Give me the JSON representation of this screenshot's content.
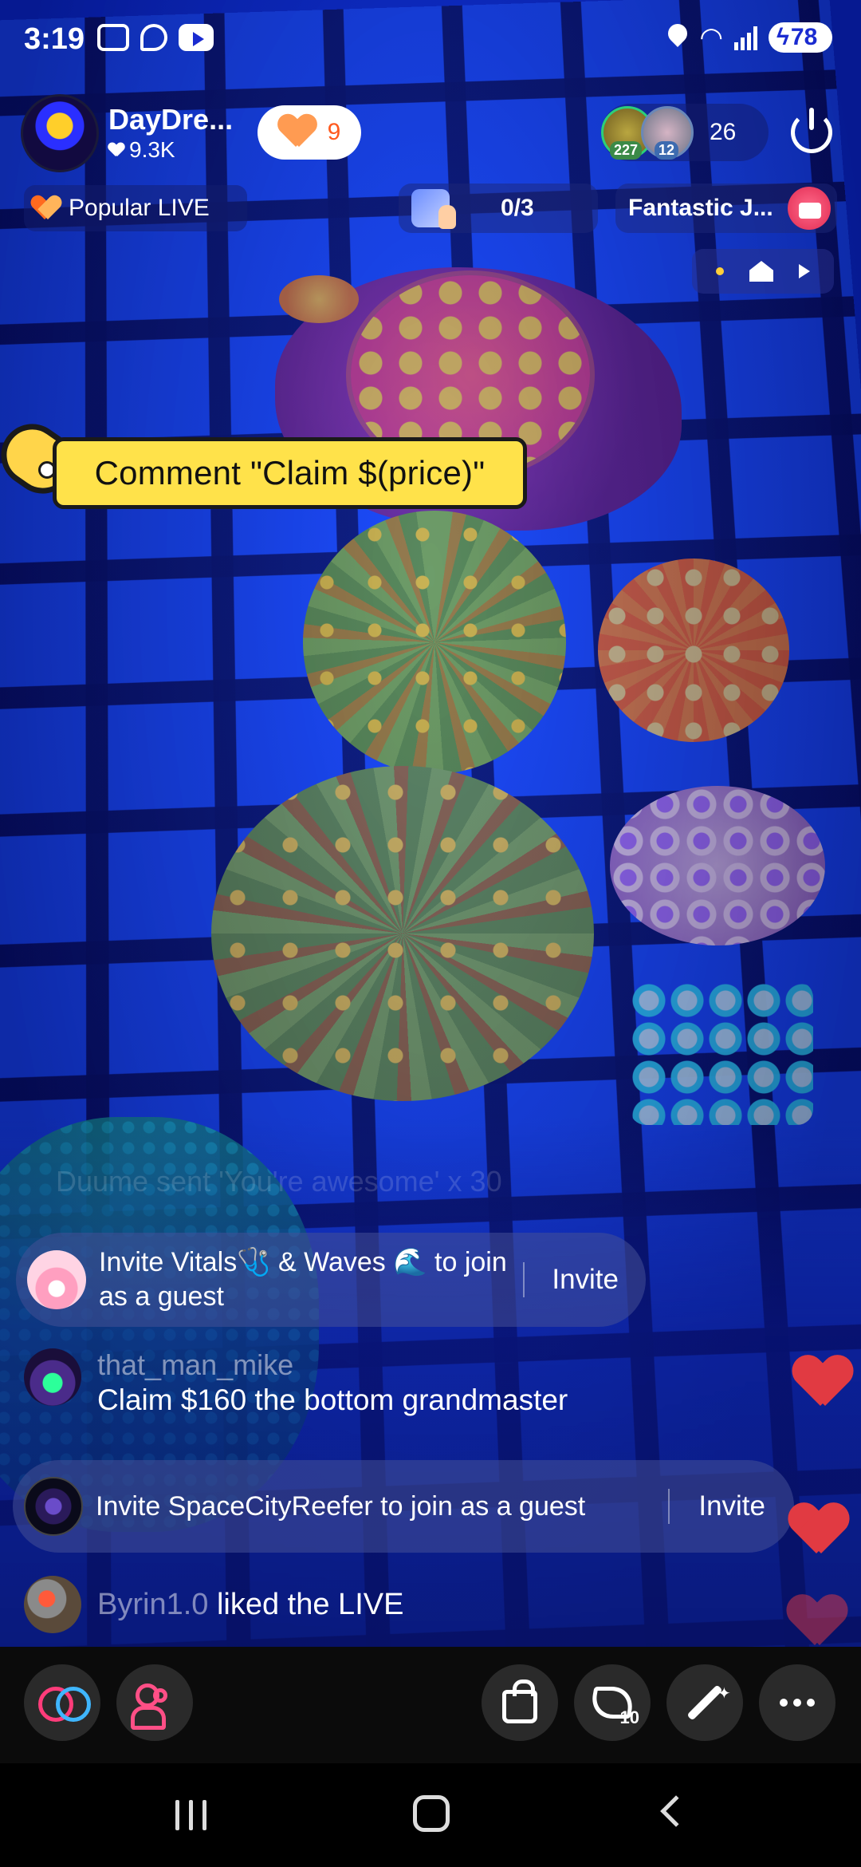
{
  "status_bar": {
    "time": "3:19",
    "battery": "78"
  },
  "host": {
    "name": "DayDre...",
    "likes": "9.3K",
    "follow_count": "9"
  },
  "viewers": {
    "badge_1": "227",
    "badge_2": "12",
    "count": "26"
  },
  "row2": {
    "popular_label": "Popular LIVE",
    "goal_progress": "0/3",
    "gift_label": "Fantastic J..."
  },
  "banner": {
    "text": "Comment \"Claim $(price)\""
  },
  "chat": {
    "faded_message": "Duume sent 'You're awesome' x 30",
    "invite_1": {
      "text": "Invite Vitals🩺 & Waves 🌊 to join as a guest",
      "button": "Invite"
    },
    "message_1": {
      "user": "that_man_mike",
      "text": "Claim $160 the bottom grandmaster"
    },
    "invite_2": {
      "text": "Invite SpaceCityReefer to join as a guest",
      "button": "Invite"
    },
    "liked": {
      "user": "Byrin1.0",
      "text": " liked the LIVE"
    }
  },
  "toolbar": {
    "share_count": "10"
  },
  "colors": {
    "accent_orange": "#ff9b52",
    "banner_yellow": "#ffe24a",
    "heart_red": "#e13a42",
    "link_pink": "#ff3c7a",
    "link_blue": "#3fb6ff"
  }
}
